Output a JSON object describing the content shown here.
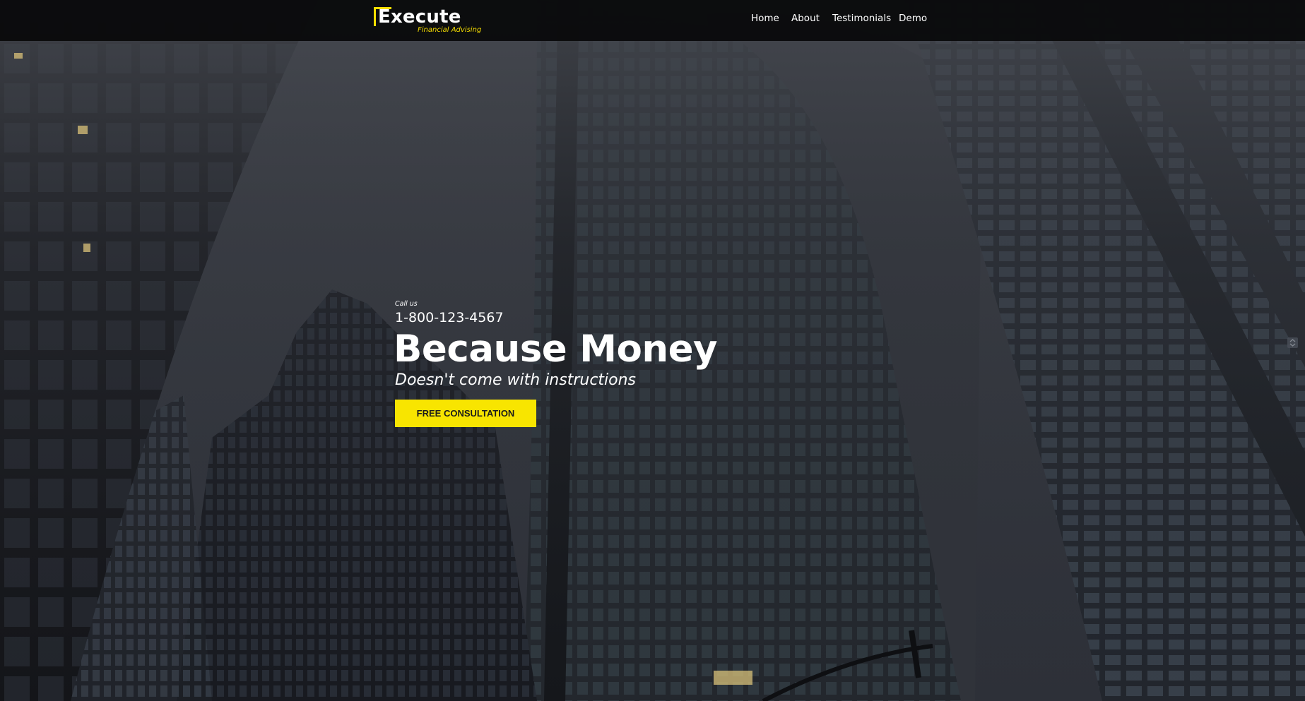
{
  "brand": {
    "name": "Execute",
    "tagline": "Financial Advising",
    "accent_color": "#f8df00"
  },
  "nav": {
    "items": [
      {
        "label": "Home"
      },
      {
        "label": "About"
      },
      {
        "label": "Testimonials"
      },
      {
        "label": "Demo"
      }
    ]
  },
  "hero": {
    "call_label": "Call us",
    "phone": "1-800-123-4567",
    "headline": "Because Money",
    "subheadline": "Doesn't come with instructions",
    "cta_label": "FREE CONSULTATION",
    "background": "dark skyscraper photo overlay",
    "cta_color": "#f8e500"
  }
}
